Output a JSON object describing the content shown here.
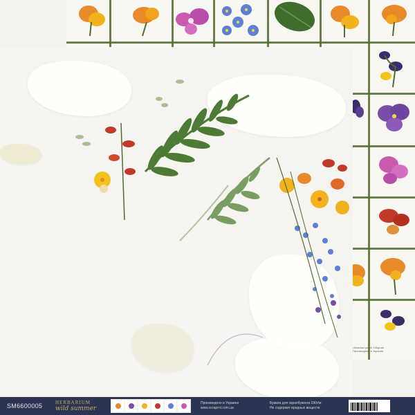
{
  "product": {
    "sku": "SM6600005",
    "brand_top": "HERBARIUM",
    "brand_bottom": "wild summer",
    "made_in_line1": "Произведено в Украине",
    "made_in_line2": "www.scraprnt.com.ua",
    "paper_line1": "Бумага для скрапбукинга 190г/м",
    "paper_line2": "Не содержит вредных веществ",
    "back_footer_line1": "Ukrainian paper 190gram",
    "back_footer_line2": "Произведено в Украине"
  },
  "colors": {
    "bar": "#2b3452",
    "brand_gold": "#c9b15a",
    "grid_green": "#4f6b2e",
    "fern_green": "#4d7a34",
    "yellow": "#f2b21d",
    "orange": "#e8892a",
    "purple": "#7a4ea8",
    "pink": "#c95ab0",
    "blue": "#5d7fd4",
    "red": "#c23a2a"
  },
  "thumbnails": [
    "orange",
    "purple",
    "yellow",
    "red",
    "blue",
    "pink"
  ]
}
